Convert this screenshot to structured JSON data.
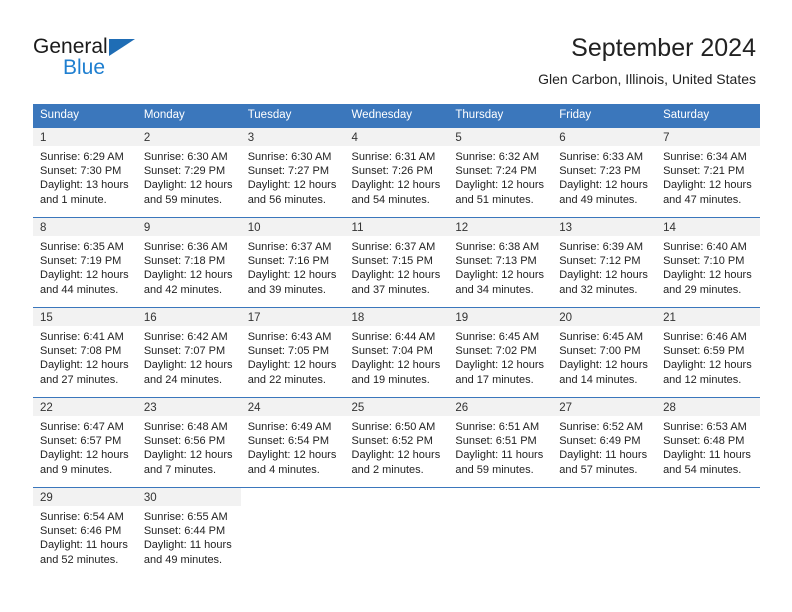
{
  "brand": {
    "name_part1": "General",
    "name_part2": "Blue",
    "triangle_color": "#1f6db5",
    "blue_color": "#1f7fd0"
  },
  "header": {
    "title": "September 2024",
    "location": "Glen Carbon, Illinois, United States"
  },
  "theme": {
    "header_row_bg": "#3b77bc",
    "header_row_text": "#ffffff",
    "daynum_bg": "#f2f2f2",
    "row_border": "#3b77bc"
  },
  "weekday_headers": [
    "Sunday",
    "Monday",
    "Tuesday",
    "Wednesday",
    "Thursday",
    "Friday",
    "Saturday"
  ],
  "weeks": [
    [
      {
        "day": "1",
        "sunrise": "Sunrise: 6:29 AM",
        "sunset": "Sunset: 7:30 PM",
        "daylight": "Daylight: 13 hours and 1 minute."
      },
      {
        "day": "2",
        "sunrise": "Sunrise: 6:30 AM",
        "sunset": "Sunset: 7:29 PM",
        "daylight": "Daylight: 12 hours and 59 minutes."
      },
      {
        "day": "3",
        "sunrise": "Sunrise: 6:30 AM",
        "sunset": "Sunset: 7:27 PM",
        "daylight": "Daylight: 12 hours and 56 minutes."
      },
      {
        "day": "4",
        "sunrise": "Sunrise: 6:31 AM",
        "sunset": "Sunset: 7:26 PM",
        "daylight": "Daylight: 12 hours and 54 minutes."
      },
      {
        "day": "5",
        "sunrise": "Sunrise: 6:32 AM",
        "sunset": "Sunset: 7:24 PM",
        "daylight": "Daylight: 12 hours and 51 minutes."
      },
      {
        "day": "6",
        "sunrise": "Sunrise: 6:33 AM",
        "sunset": "Sunset: 7:23 PM",
        "daylight": "Daylight: 12 hours and 49 minutes."
      },
      {
        "day": "7",
        "sunrise": "Sunrise: 6:34 AM",
        "sunset": "Sunset: 7:21 PM",
        "daylight": "Daylight: 12 hours and 47 minutes."
      }
    ],
    [
      {
        "day": "8",
        "sunrise": "Sunrise: 6:35 AM",
        "sunset": "Sunset: 7:19 PM",
        "daylight": "Daylight: 12 hours and 44 minutes."
      },
      {
        "day": "9",
        "sunrise": "Sunrise: 6:36 AM",
        "sunset": "Sunset: 7:18 PM",
        "daylight": "Daylight: 12 hours and 42 minutes."
      },
      {
        "day": "10",
        "sunrise": "Sunrise: 6:37 AM",
        "sunset": "Sunset: 7:16 PM",
        "daylight": "Daylight: 12 hours and 39 minutes."
      },
      {
        "day": "11",
        "sunrise": "Sunrise: 6:37 AM",
        "sunset": "Sunset: 7:15 PM",
        "daylight": "Daylight: 12 hours and 37 minutes."
      },
      {
        "day": "12",
        "sunrise": "Sunrise: 6:38 AM",
        "sunset": "Sunset: 7:13 PM",
        "daylight": "Daylight: 12 hours and 34 minutes."
      },
      {
        "day": "13",
        "sunrise": "Sunrise: 6:39 AM",
        "sunset": "Sunset: 7:12 PM",
        "daylight": "Daylight: 12 hours and 32 minutes."
      },
      {
        "day": "14",
        "sunrise": "Sunrise: 6:40 AM",
        "sunset": "Sunset: 7:10 PM",
        "daylight": "Daylight: 12 hours and 29 minutes."
      }
    ],
    [
      {
        "day": "15",
        "sunrise": "Sunrise: 6:41 AM",
        "sunset": "Sunset: 7:08 PM",
        "daylight": "Daylight: 12 hours and 27 minutes."
      },
      {
        "day": "16",
        "sunrise": "Sunrise: 6:42 AM",
        "sunset": "Sunset: 7:07 PM",
        "daylight": "Daylight: 12 hours and 24 minutes."
      },
      {
        "day": "17",
        "sunrise": "Sunrise: 6:43 AM",
        "sunset": "Sunset: 7:05 PM",
        "daylight": "Daylight: 12 hours and 22 minutes."
      },
      {
        "day": "18",
        "sunrise": "Sunrise: 6:44 AM",
        "sunset": "Sunset: 7:04 PM",
        "daylight": "Daylight: 12 hours and 19 minutes."
      },
      {
        "day": "19",
        "sunrise": "Sunrise: 6:45 AM",
        "sunset": "Sunset: 7:02 PM",
        "daylight": "Daylight: 12 hours and 17 minutes."
      },
      {
        "day": "20",
        "sunrise": "Sunrise: 6:45 AM",
        "sunset": "Sunset: 7:00 PM",
        "daylight": "Daylight: 12 hours and 14 minutes."
      },
      {
        "day": "21",
        "sunrise": "Sunrise: 6:46 AM",
        "sunset": "Sunset: 6:59 PM",
        "daylight": "Daylight: 12 hours and 12 minutes."
      }
    ],
    [
      {
        "day": "22",
        "sunrise": "Sunrise: 6:47 AM",
        "sunset": "Sunset: 6:57 PM",
        "daylight": "Daylight: 12 hours and 9 minutes."
      },
      {
        "day": "23",
        "sunrise": "Sunrise: 6:48 AM",
        "sunset": "Sunset: 6:56 PM",
        "daylight": "Daylight: 12 hours and 7 minutes."
      },
      {
        "day": "24",
        "sunrise": "Sunrise: 6:49 AM",
        "sunset": "Sunset: 6:54 PM",
        "daylight": "Daylight: 12 hours and 4 minutes."
      },
      {
        "day": "25",
        "sunrise": "Sunrise: 6:50 AM",
        "sunset": "Sunset: 6:52 PM",
        "daylight": "Daylight: 12 hours and 2 minutes."
      },
      {
        "day": "26",
        "sunrise": "Sunrise: 6:51 AM",
        "sunset": "Sunset: 6:51 PM",
        "daylight": "Daylight: 11 hours and 59 minutes."
      },
      {
        "day": "27",
        "sunrise": "Sunrise: 6:52 AM",
        "sunset": "Sunset: 6:49 PM",
        "daylight": "Daylight: 11 hours and 57 minutes."
      },
      {
        "day": "28",
        "sunrise": "Sunrise: 6:53 AM",
        "sunset": "Sunset: 6:48 PM",
        "daylight": "Daylight: 11 hours and 54 minutes."
      }
    ],
    [
      {
        "day": "29",
        "sunrise": "Sunrise: 6:54 AM",
        "sunset": "Sunset: 6:46 PM",
        "daylight": "Daylight: 11 hours and 52 minutes."
      },
      {
        "day": "30",
        "sunrise": "Sunrise: 6:55 AM",
        "sunset": "Sunset: 6:44 PM",
        "daylight": "Daylight: 11 hours and 49 minutes."
      },
      {
        "day": "",
        "sunrise": "",
        "sunset": "",
        "daylight": ""
      },
      {
        "day": "",
        "sunrise": "",
        "sunset": "",
        "daylight": ""
      },
      {
        "day": "",
        "sunrise": "",
        "sunset": "",
        "daylight": ""
      },
      {
        "day": "",
        "sunrise": "",
        "sunset": "",
        "daylight": ""
      },
      {
        "day": "",
        "sunrise": "",
        "sunset": "",
        "daylight": ""
      }
    ]
  ]
}
